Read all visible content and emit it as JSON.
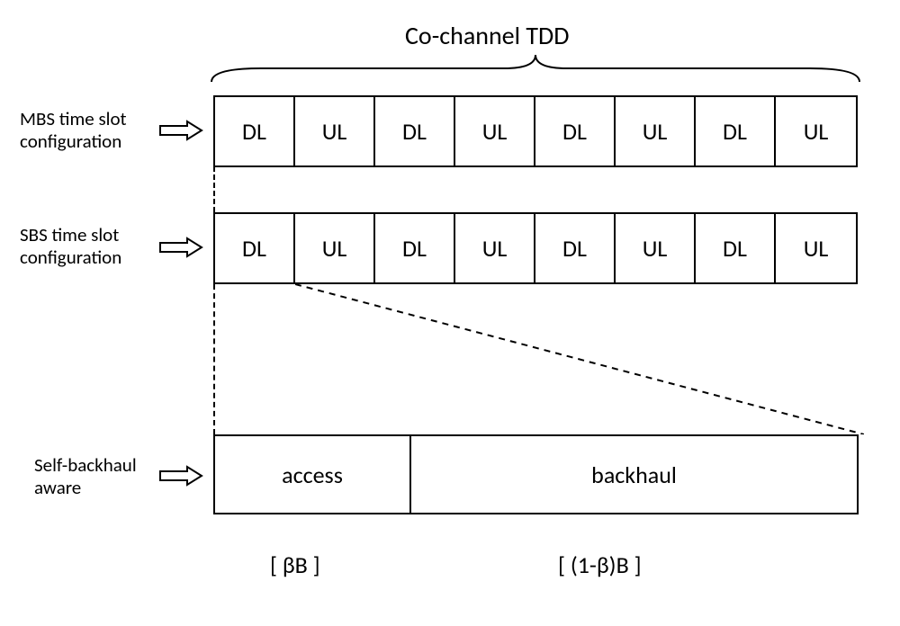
{
  "title": "Co-channel TDD",
  "rows": {
    "mbs": {
      "label": "MBS time slot\nconfiguration",
      "slots": [
        "DL",
        "UL",
        "DL",
        "UL",
        "DL",
        "UL",
        "DL",
        "UL"
      ]
    },
    "sbs": {
      "label": "SBS  time slot\nconfiguration",
      "slots": [
        "DL",
        "UL",
        "DL",
        "UL",
        "DL",
        "UL",
        "DL",
        "UL"
      ]
    },
    "selfbackhaul": {
      "label": "Self-backhaul\naware",
      "access": "access",
      "backhaul": "backhaul"
    }
  },
  "formulas": {
    "access": "[ βB ]",
    "backhaul": "[ (1-β)B ]"
  },
  "chart_data": {
    "type": "table",
    "description": "TDD time-slot configuration for co-channel MBS/SBS with self-backhaul bandwidth split",
    "mbs_slots": [
      "DL",
      "UL",
      "DL",
      "UL",
      "DL",
      "UL",
      "DL",
      "UL"
    ],
    "sbs_slots": [
      "DL",
      "UL",
      "DL",
      "UL",
      "DL",
      "UL",
      "DL",
      "UL"
    ],
    "sbs_slot_expansion": {
      "expanded_slot_index": 0,
      "subdivisions": [
        {
          "label": "access",
          "bandwidth": "βB"
        },
        {
          "label": "backhaul",
          "bandwidth": "(1-β)B"
        }
      ]
    }
  }
}
